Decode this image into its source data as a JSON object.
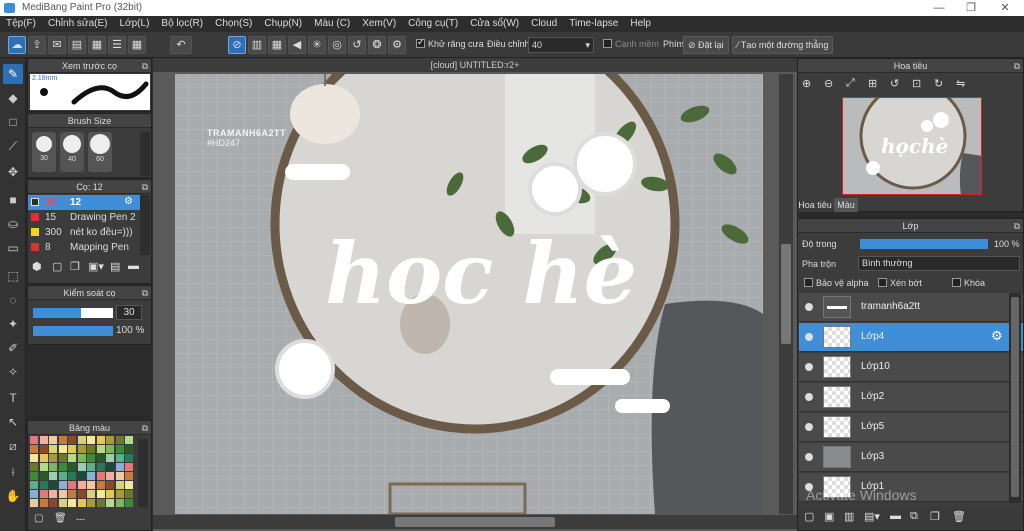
{
  "window": {
    "title": "MediBang Paint Pro (32bit)",
    "controls": [
      "—",
      "❐",
      "✕"
    ]
  },
  "menu": [
    "Tệp(F)",
    "Chỉnh sửa(E)",
    "Lớp(L)",
    "Bộ lọc(R)",
    "Chọn(S)",
    "Chụp(N)",
    "Màu (C)",
    "Xem(V)",
    "Công cụ(T)",
    "Cửa sổ(W)",
    "Cloud",
    "Time-lapse",
    "Help"
  ],
  "toolbar": {
    "antialias_label": "Khử răng cưa",
    "adjust_label": "Điều chỉnh",
    "adjust_value": "40",
    "snap_label": "Cạnh mềm",
    "keys_label": "Phím",
    "reset_label": "Đặt lại",
    "line_label": "Tạo một đường thẳng"
  },
  "brush_preview": {
    "title": "Xem trước cọ",
    "size": "2.18mm"
  },
  "brush_size": {
    "title": "Brush Size",
    "sizes": [
      "30",
      "40",
      "60"
    ]
  },
  "brush_list": {
    "title": "Cọ: 12",
    "items": [
      {
        "size": "30",
        "name": "12",
        "color": "#2d2d2d",
        "selected": true
      },
      {
        "size": "15",
        "name": "Drawing Pen 2",
        "color": "#e03030",
        "selected": false
      },
      {
        "size": "300",
        "name": "nét ko đều=)))",
        "color": "#f2d21a",
        "selected": false
      },
      {
        "size": "8",
        "name": "Mapping Pen",
        "color": "#e03030",
        "selected": false
      }
    ]
  },
  "brush_control": {
    "title": "Kiểm soát cọ",
    "size_value": "30",
    "opacity_value": "100 %",
    "size_fraction": 0.6,
    "opacity_fraction": 1.0
  },
  "palette": {
    "title": "Bảng màu",
    "footer": "---"
  },
  "canvas": {
    "tab": "[cloud] UNTITLED:r2+",
    "watermark_top": "TRAMANH6A2TT",
    "watermark_sub": "#HD247",
    "main_text": "hoc hè"
  },
  "navigator": {
    "title": "Hoa tiêu",
    "tab1": "Hoa tiêu",
    "tab2": "Màu"
  },
  "layers": {
    "title": "Lớp",
    "opacity_label": "Độ trong",
    "opacity_value": "100 %",
    "opacity_fraction": 1.0,
    "blend_label": "Pha trộn",
    "blend_value": "Bình thường",
    "protect_alpha": "Bảo vệ alpha",
    "clip": "Xén bớt",
    "lock": "Khóa",
    "items": [
      {
        "name": "tramanh6a2tt",
        "selected": false
      },
      {
        "name": "Lớp4",
        "selected": true
      },
      {
        "name": "Lớp10",
        "selected": false
      },
      {
        "name": "Lớp2",
        "selected": false
      },
      {
        "name": "Lớp5",
        "selected": false
      },
      {
        "name": "Lớp3",
        "selected": false
      },
      {
        "name": "Lớp1",
        "selected": false
      }
    ]
  },
  "os_watermark": "Activate Windows",
  "colors": {
    "accent": "#3f8ed8",
    "panel": "#3c3c3c",
    "selection": "#2f6fb3"
  }
}
